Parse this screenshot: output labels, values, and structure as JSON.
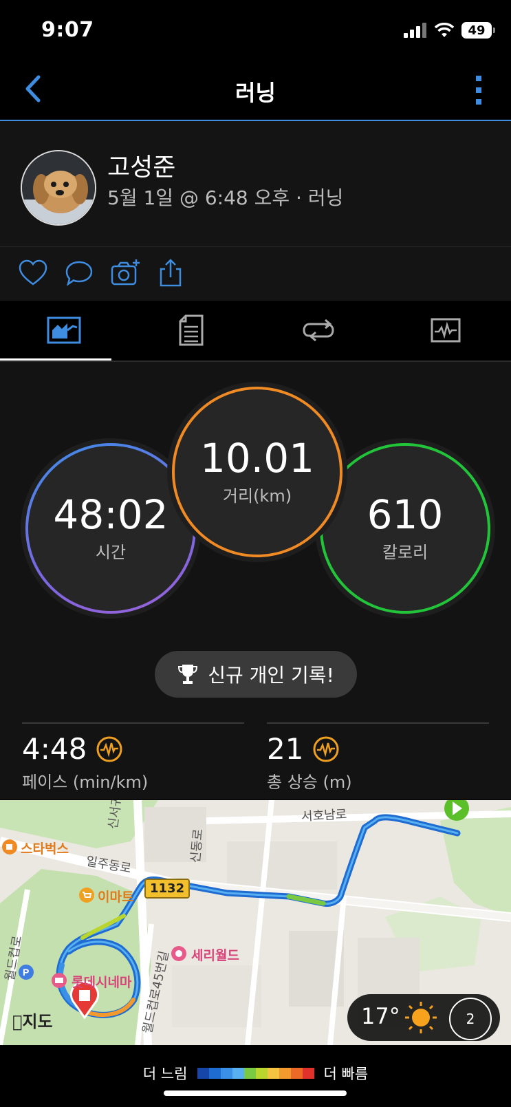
{
  "status": {
    "time": "9:07",
    "battery": "49"
  },
  "nav": {
    "title": "러닝"
  },
  "profile": {
    "name": "고성준",
    "meta": "5월 1일 @ 6:48 오후 · 러닝"
  },
  "stats": {
    "time": {
      "value": "48:02",
      "label": "시간"
    },
    "distance": {
      "value": "10.01",
      "label": "거리(km)"
    },
    "calories": {
      "value": "610",
      "label": "칼로리"
    },
    "record_label": "신규 개인 기록!",
    "pace": {
      "value": "4:48",
      "label": "페이스 (min/km)"
    },
    "ascent": {
      "value": "21",
      "label": "총 상승 (m)"
    }
  },
  "map": {
    "labels": {
      "starbucks": "스타벅스",
      "emart": "이마트",
      "seriworld": "세리월드",
      "lottecinema": "롯데시네마",
      "road_iljudong": "일주동로",
      "road_seohonamro": "서호남로",
      "road_sinseogwiro": "신서귀로",
      "road_sindongro": "신동로",
      "road_worldcup": "월드컵로",
      "road_worldcup45": "월드컵로45번길",
      "route_1132": "1132"
    },
    "attribution": "지도",
    "weather": {
      "temp": "17°",
      "wind": "2"
    }
  },
  "legend": {
    "slow": "더 느림",
    "fast": "더 빠름",
    "colors": [
      "#1646a8",
      "#1e6bd1",
      "#3a8fe6",
      "#58b0f0",
      "#7ac943",
      "#b9d52e",
      "#f6c441",
      "#f39a2e",
      "#ec6a25",
      "#e0312a"
    ]
  }
}
